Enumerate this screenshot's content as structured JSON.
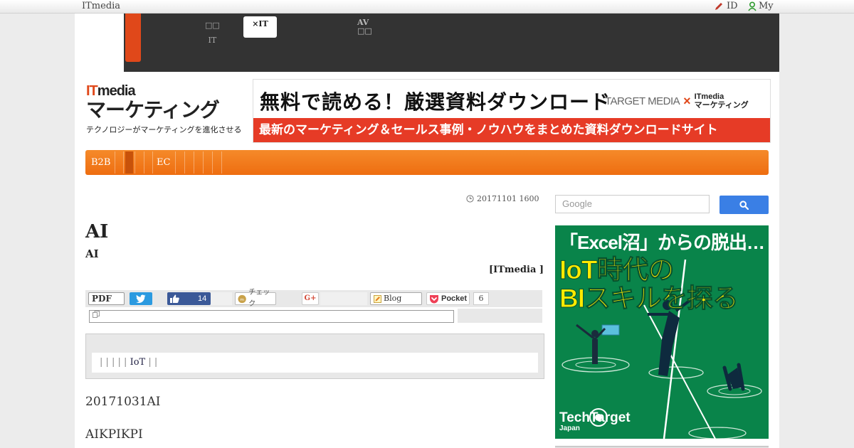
{
  "topbar": {
    "brand": "ITmedia",
    "id_label": "ID",
    "my_label": "My"
  },
  "channel_nav": {
    "item_it": "IT",
    "active_line1": "",
    "active_line2": "×IT",
    "item_av": "AV"
  },
  "logo": {
    "line1_it": "IT",
    "line1_media": "media",
    "line2": "マーケティング",
    "tagline": "テクノロジーがマーケティングを進化させる"
  },
  "banner": {
    "headline": "無料で読める！厳選資料ダウンロード",
    "brand_target": "TARGET MEDIA",
    "brand_x": "×",
    "brand_it": "ITmedia",
    "brand_mk": "マーケティング",
    "strip": "最新のマーケティング＆セールス事例・ノウハウをまとめた資料ダウンロードサイト"
  },
  "category_nav": {
    "b2b": "B2B",
    "ec": "EC"
  },
  "article": {
    "timestamp": "20171101 1600",
    "title": "AI",
    "subtitle": "AI",
    "credit": "[ITmedia ]",
    "para1": "20171031AI",
    "para2": "AIKPIKPI"
  },
  "share": {
    "pdf": "PDF",
    "fb_count": "14",
    "check": "チェック",
    "gplus": "G+",
    "blog": "Blog",
    "pocket": "Pocket",
    "pocket_count": "6"
  },
  "related": {
    "separators": "| | | | |",
    "tag": "IoT",
    "trailing": "| |"
  },
  "search": {
    "placeholder": "Google"
  },
  "ad": {
    "line1": "「Excel沼」からの脱出…",
    "line2": "IoT時代の",
    "line3": "BIスキルを探る",
    "brand": "TechTarget",
    "brand_sub": "Japan"
  },
  "colors": {
    "accent_orange": "#ee6d10",
    "banner_red": "#e63b26",
    "ad_green": "#09844a",
    "ad_yellow": "#ffea00",
    "search_blue": "#3a7fe5",
    "twitter_blue": "#2b9ae0",
    "facebook_blue": "#3b5998"
  }
}
